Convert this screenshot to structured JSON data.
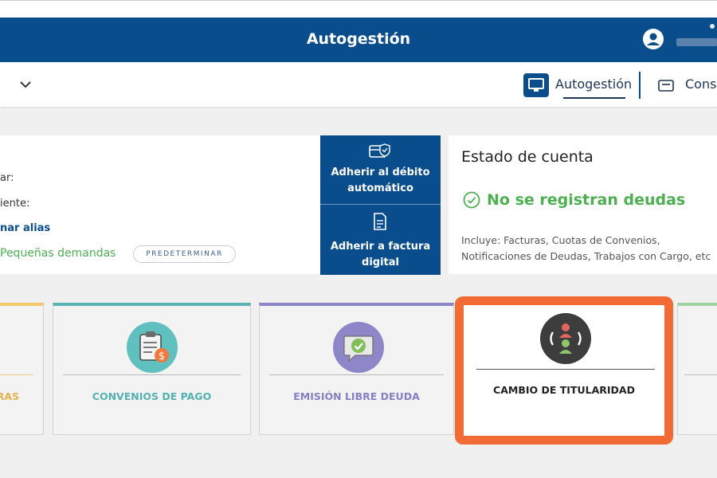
{
  "header": {
    "title": "Autogestión"
  },
  "nav": {
    "active_label": "Autogestión",
    "second_label": "Cons"
  },
  "account_card": {
    "field1": "ar:",
    "field2": "iente:",
    "alias_link": "nar alias",
    "plan": "Pequeñas demandas",
    "default_button": "PREDETERMINAR"
  },
  "actions": {
    "debit": [
      "Adherir al débito",
      "automático"
    ],
    "invoice": [
      "Adherir a factura",
      "digital"
    ]
  },
  "status": {
    "title": "Estado de cuenta",
    "message": "No se registran deudas",
    "note_line1": "Incluye: Facturas, Cuotas de Convenios,",
    "note_line2": "Notificaciones de Deudas, Trabajos con Cargo, etc"
  },
  "tiles": [
    {
      "label": "RAS",
      "accent": "#f2c96b"
    },
    {
      "label": "CONVENIOS DE PAGO",
      "accent": "#5cb3b3"
    },
    {
      "label": "EMISIÓN LIBRE DEUDA",
      "accent": "#8a86c7"
    },
    {
      "label": "CAMBIO DE TITULARIDAD",
      "accent": "#f26b35"
    }
  ],
  "colors": {
    "primary": "#0a4d8c",
    "success": "#4caf50",
    "highlight": "#f26b35"
  }
}
